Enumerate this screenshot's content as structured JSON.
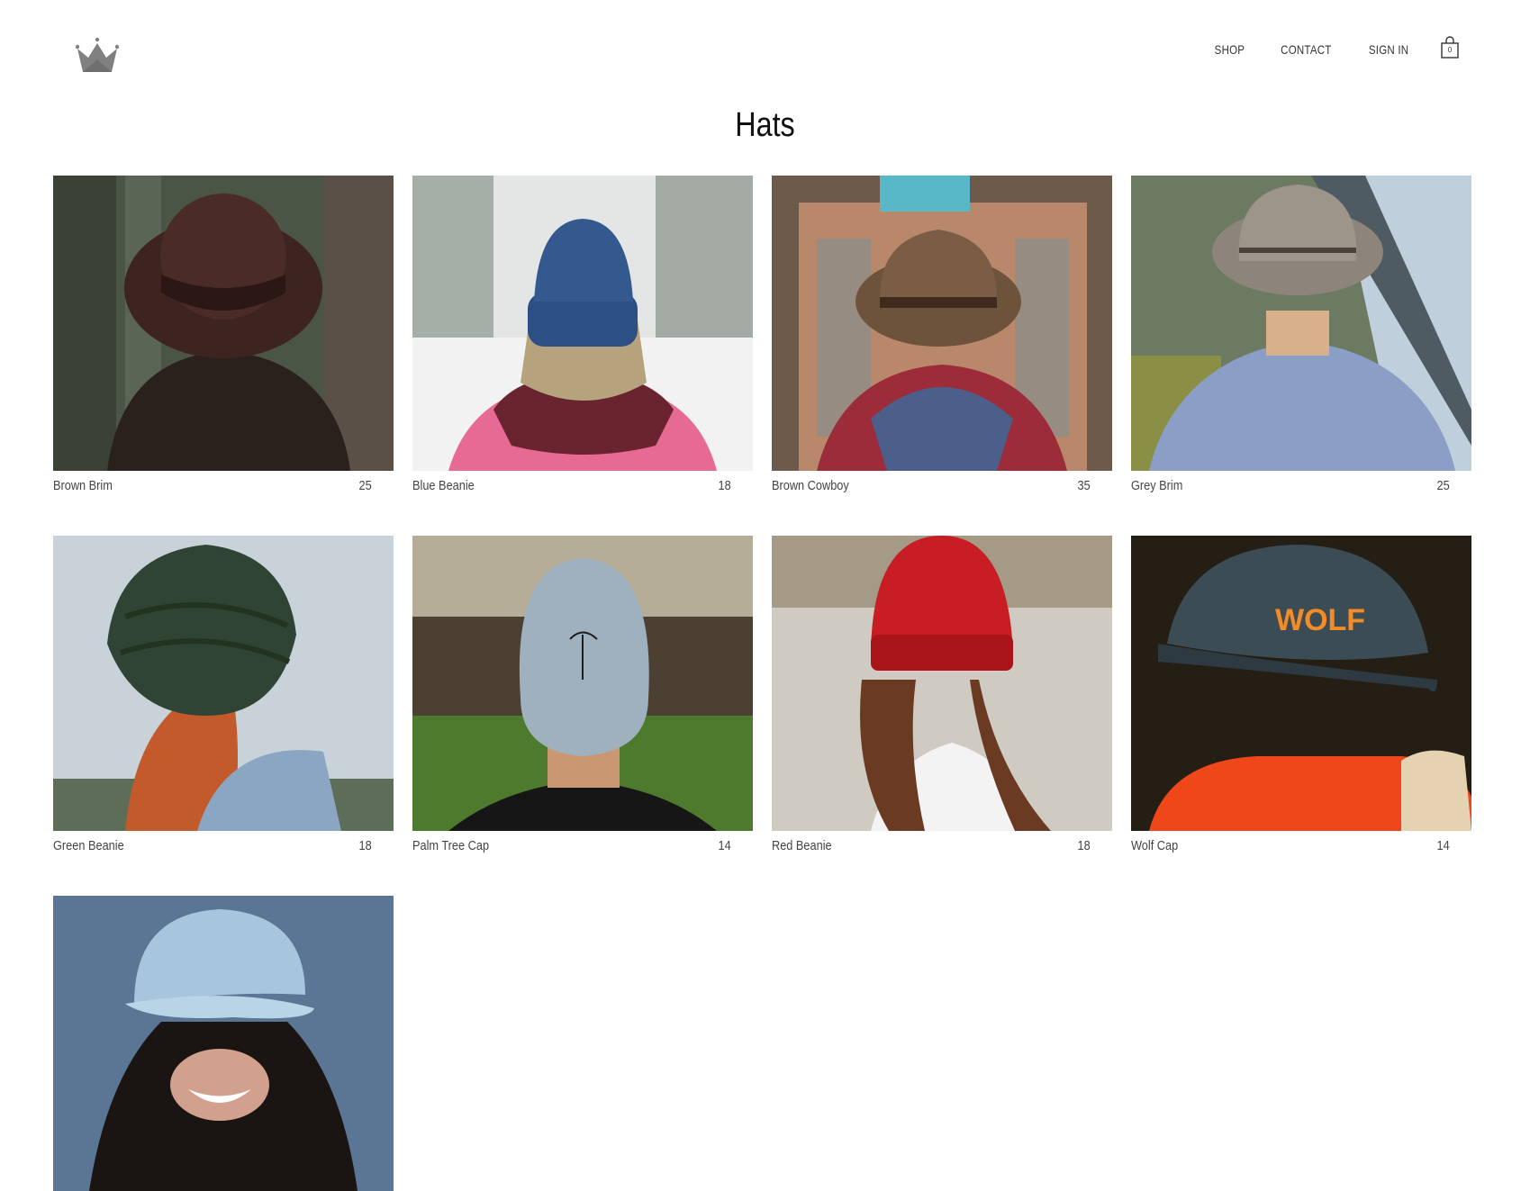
{
  "header": {
    "logo_icon": "crown-icon",
    "nav": [
      {
        "label": "SHOP"
      },
      {
        "label": "CONTACT"
      },
      {
        "label": "SIGN IN"
      }
    ],
    "cart": {
      "icon": "shopping-bag-icon",
      "count": "0"
    }
  },
  "page": {
    "title": "Hats"
  },
  "products": [
    {
      "name": "Brown Brim",
      "price": "25"
    },
    {
      "name": "Blue Beanie",
      "price": "18"
    },
    {
      "name": "Brown Cowboy",
      "price": "35"
    },
    {
      "name": "Grey Brim",
      "price": "25"
    },
    {
      "name": "Green Beanie",
      "price": "18"
    },
    {
      "name": "Palm Tree Cap",
      "price": "14"
    },
    {
      "name": "Red Beanie",
      "price": "18"
    },
    {
      "name": "Wolf Cap",
      "price": "14"
    },
    {
      "name": "",
      "price": ""
    }
  ],
  "colors": {
    "logo": "#808080",
    "text": "#333333",
    "background": "#ffffff"
  }
}
